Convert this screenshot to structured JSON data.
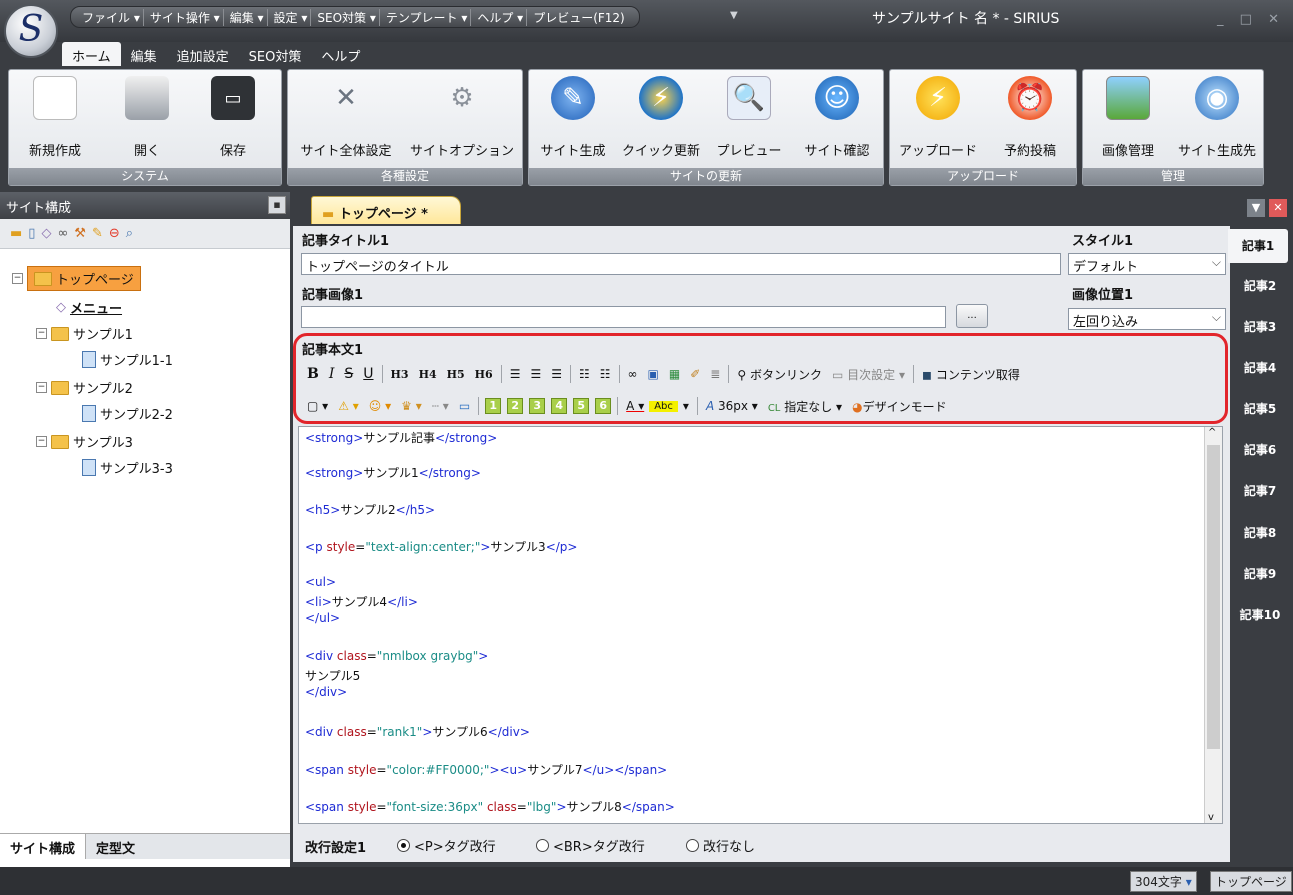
{
  "title_menu": [
    "ファイル ▾",
    "サイト操作 ▾",
    "編集 ▾",
    "設定 ▾",
    "SEO対策 ▾",
    "テンプレート ▾",
    "ヘルプ ▾",
    "プレビュー(F12)"
  ],
  "window_title": "サンプルサイト 名 * - SIRIUS",
  "logo_letter": "S",
  "ribbon_tabs": [
    "ホーム",
    "編集",
    "追加設定",
    "SEO対策",
    "ヘルプ"
  ],
  "groups": {
    "system": {
      "label": "システム",
      "buttons": [
        "新規作成",
        "開く",
        "保存"
      ]
    },
    "settings": {
      "label": "各種設定",
      "buttons": [
        "サイト全体設定",
        "サイトオプション"
      ]
    },
    "update": {
      "label": "サイトの更新",
      "buttons": [
        "サイト生成",
        "クイック更新",
        "プレビュー",
        "サイト確認"
      ]
    },
    "upload": {
      "label": "アップロード",
      "buttons": [
        "アップロード",
        "予約投稿"
      ]
    },
    "manage": {
      "label": "管理",
      "buttons": [
        "画像管理",
        "サイト生成先"
      ]
    }
  },
  "left_panel": {
    "title": "サイト構成",
    "tree": [
      "トップページ",
      "メニュー",
      "サンプル1",
      "サンプル1-1",
      "サンプル2",
      "サンプル2-2",
      "サンプル3",
      "サンプル3-3"
    ],
    "bottom_tabs": [
      "サイト構成",
      "定型文"
    ]
  },
  "doc_tab": "トップページ *",
  "fields": {
    "title_label": "記事タイトル1",
    "title_value": "トップページのタイトル",
    "style_label": "スタイル1",
    "style_value": "デフォルト",
    "image_label": "記事画像1",
    "image_value": "",
    "browse": "...",
    "position_label": "画像位置1",
    "position_value": "左回り込み",
    "body_label": "記事本文1"
  },
  "toolbar1": [
    "B",
    "I",
    "S",
    "U",
    "H3",
    "H4",
    "H5",
    "H6",
    "ボタンリンク",
    "目次設定",
    "コンテンツ取得"
  ],
  "toolbar2": [
    "1",
    "2",
    "3",
    "4",
    "5",
    "6",
    "36px",
    "指定なし",
    "デザインモード"
  ],
  "code": {
    "l1": "サンプル記事",
    "l2": "サンプル1",
    "l3": "サンプル2",
    "l4a": "text-align:center;",
    "l4b": "サンプル3",
    "l5": "サンプル4",
    "l6a": "nmlbox graybg",
    "l6b": "サンプル5",
    "l7a": "rank1",
    "l7b": "サンプル6",
    "l8a": "color:#FF0000;",
    "l8b": "サンプル7",
    "l9a": "font-size:36px",
    "l9b": "lbg",
    "l9c": "サンプル8"
  },
  "linebreak": {
    "label": "改行設定1",
    "options": [
      "<P>タグ改行",
      "<BR>タグ改行",
      "改行なし"
    ],
    "selected": 0
  },
  "article_tabs": [
    "記事1",
    "記事2",
    "記事3",
    "記事4",
    "記事5",
    "記事6",
    "記事7",
    "記事8",
    "記事9",
    "記事10"
  ],
  "status": {
    "chars": "304文字",
    "page": "トップページ"
  }
}
